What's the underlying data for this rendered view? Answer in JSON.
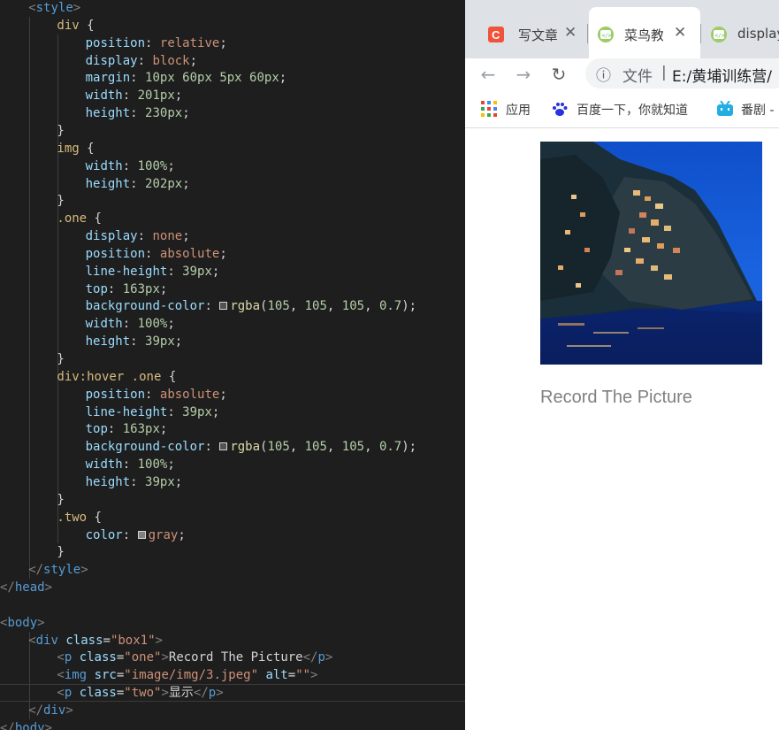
{
  "editor": {
    "lines": [
      [
        [
          "c-bracket",
          "<"
        ],
        [
          "c-tag",
          "style"
        ],
        [
          "c-bracket",
          ">"
        ]
      ],
      [
        [
          "c-sel",
          "div"
        ],
        [
          "c-plain",
          " {"
        ]
      ],
      [
        [
          "c-prop",
          "position"
        ],
        [
          "c-plain",
          ": "
        ],
        [
          "c-val",
          "relative"
        ],
        [
          "c-plain",
          ";"
        ]
      ],
      [
        [
          "c-prop",
          "display"
        ],
        [
          "c-plain",
          ": "
        ],
        [
          "c-val",
          "block"
        ],
        [
          "c-plain",
          ";"
        ]
      ],
      [
        [
          "c-prop",
          "margin"
        ],
        [
          "c-plain",
          ": "
        ],
        [
          "c-num",
          "10px 60px 5px 60px"
        ],
        [
          "c-plain",
          ";"
        ]
      ],
      [
        [
          "c-prop",
          "width"
        ],
        [
          "c-plain",
          ": "
        ],
        [
          "c-num",
          "201px"
        ],
        [
          "c-plain",
          ";"
        ]
      ],
      [
        [
          "c-prop",
          "height"
        ],
        [
          "c-plain",
          ": "
        ],
        [
          "c-num",
          "230px"
        ],
        [
          "c-plain",
          ";"
        ]
      ],
      [
        [
          "c-plain",
          "}"
        ]
      ],
      [
        [
          "c-sel",
          "img"
        ],
        [
          "c-plain",
          " {"
        ]
      ],
      [
        [
          "c-prop",
          "width"
        ],
        [
          "c-plain",
          ": "
        ],
        [
          "c-num",
          "100%"
        ],
        [
          "c-plain",
          ";"
        ]
      ],
      [
        [
          "c-prop",
          "height"
        ],
        [
          "c-plain",
          ": "
        ],
        [
          "c-num",
          "202px"
        ],
        [
          "c-plain",
          ";"
        ]
      ],
      [
        [
          "c-plain",
          "}"
        ]
      ],
      [
        [
          "c-sel",
          ".one"
        ],
        [
          "c-plain",
          " {"
        ]
      ],
      [
        [
          "c-prop",
          "display"
        ],
        [
          "c-plain",
          ": "
        ],
        [
          "c-val",
          "none"
        ],
        [
          "c-plain",
          ";"
        ]
      ],
      [
        [
          "c-prop",
          "position"
        ],
        [
          "c-plain",
          ": "
        ],
        [
          "c-val",
          "absolute"
        ],
        [
          "c-plain",
          ";"
        ]
      ],
      [
        [
          "c-prop",
          "line-height"
        ],
        [
          "c-plain",
          ": "
        ],
        [
          "c-num",
          "39px"
        ],
        [
          "c-plain",
          ";"
        ]
      ],
      [
        [
          "c-prop",
          "top"
        ],
        [
          "c-plain",
          ": "
        ],
        [
          "c-num",
          "163px"
        ],
        [
          "c-plain",
          ";"
        ]
      ],
      [
        [
          "c-prop",
          "background-color"
        ],
        [
          "c-plain",
          ": "
        ],
        [
          "swatch",
          "rgba(105,105,105,0.7)"
        ],
        [
          "c-fn",
          "rgba"
        ],
        [
          "c-plain",
          "("
        ],
        [
          "c-num",
          "105"
        ],
        [
          "c-plain",
          ", "
        ],
        [
          "c-num",
          "105"
        ],
        [
          "c-plain",
          ", "
        ],
        [
          "c-num",
          "105"
        ],
        [
          "c-plain",
          ", "
        ],
        [
          "c-num",
          "0.7"
        ],
        [
          "c-plain",
          ");"
        ]
      ],
      [
        [
          "c-prop",
          "width"
        ],
        [
          "c-plain",
          ": "
        ],
        [
          "c-num",
          "100%"
        ],
        [
          "c-plain",
          ";"
        ]
      ],
      [
        [
          "c-prop",
          "height"
        ],
        [
          "c-plain",
          ": "
        ],
        [
          "c-num",
          "39px"
        ],
        [
          "c-plain",
          ";"
        ]
      ],
      [
        [
          "c-plain",
          "}"
        ]
      ],
      [
        [
          "c-sel",
          "div:hover .one"
        ],
        [
          "c-plain",
          " {"
        ]
      ],
      [
        [
          "c-prop",
          "position"
        ],
        [
          "c-plain",
          ": "
        ],
        [
          "c-val",
          "absolute"
        ],
        [
          "c-plain",
          ";"
        ]
      ],
      [
        [
          "c-prop",
          "line-height"
        ],
        [
          "c-plain",
          ": "
        ],
        [
          "c-num",
          "39px"
        ],
        [
          "c-plain",
          ";"
        ]
      ],
      [
        [
          "c-prop",
          "top"
        ],
        [
          "c-plain",
          ": "
        ],
        [
          "c-num",
          "163px"
        ],
        [
          "c-plain",
          ";"
        ]
      ],
      [
        [
          "c-prop",
          "background-color"
        ],
        [
          "c-plain",
          ": "
        ],
        [
          "swatch",
          "rgba(105,105,105,0.7)"
        ],
        [
          "c-fn",
          "rgba"
        ],
        [
          "c-plain",
          "("
        ],
        [
          "c-num",
          "105"
        ],
        [
          "c-plain",
          ", "
        ],
        [
          "c-num",
          "105"
        ],
        [
          "c-plain",
          ", "
        ],
        [
          "c-num",
          "105"
        ],
        [
          "c-plain",
          ", "
        ],
        [
          "c-num",
          "0.7"
        ],
        [
          "c-plain",
          ");"
        ]
      ],
      [
        [
          "c-prop",
          "width"
        ],
        [
          "c-plain",
          ": "
        ],
        [
          "c-num",
          "100%"
        ],
        [
          "c-plain",
          ";"
        ]
      ],
      [
        [
          "c-prop",
          "height"
        ],
        [
          "c-plain",
          ": "
        ],
        [
          "c-num",
          "39px"
        ],
        [
          "c-plain",
          ";"
        ]
      ],
      [
        [
          "c-plain",
          "}"
        ]
      ],
      [
        [
          "c-sel",
          ".two"
        ],
        [
          "c-plain",
          " {"
        ]
      ],
      [
        [
          "c-prop",
          "color"
        ],
        [
          "c-plain",
          ": "
        ],
        [
          "swatch",
          "gray"
        ],
        [
          "c-val",
          "gray"
        ],
        [
          "c-plain",
          ";"
        ]
      ],
      [
        [
          "c-plain",
          "}"
        ]
      ],
      [
        [
          "c-bracket",
          "</"
        ],
        [
          "c-tag",
          "style"
        ],
        [
          "c-bracket",
          ">"
        ]
      ],
      [
        [
          "c-bracket",
          "</"
        ],
        [
          "c-tag",
          "head"
        ],
        [
          "c-bracket",
          ">"
        ]
      ],
      [],
      [
        [
          "c-bracket",
          "<"
        ],
        [
          "c-tag",
          "body"
        ],
        [
          "c-bracket",
          ">"
        ]
      ],
      [
        [
          "c-bracket",
          "<"
        ],
        [
          "c-tag",
          "div"
        ],
        [
          "c-plain",
          " "
        ],
        [
          "c-attr",
          "class"
        ],
        [
          "c-plain",
          "="
        ],
        [
          "c-str",
          "\"box1\""
        ],
        [
          "c-bracket",
          ">"
        ]
      ],
      [
        [
          "c-bracket",
          "<"
        ],
        [
          "c-tag",
          "p"
        ],
        [
          "c-plain",
          " "
        ],
        [
          "c-attr",
          "class"
        ],
        [
          "c-plain",
          "="
        ],
        [
          "c-str",
          "\"one\""
        ],
        [
          "c-bracket",
          ">"
        ],
        [
          "c-plain",
          "Record The Picture"
        ],
        [
          "c-bracket",
          "</"
        ],
        [
          "c-tag",
          "p"
        ],
        [
          "c-bracket",
          ">"
        ]
      ],
      [
        [
          "c-bracket",
          "<"
        ],
        [
          "c-tag",
          "img"
        ],
        [
          "c-plain",
          " "
        ],
        [
          "c-attr",
          "src"
        ],
        [
          "c-plain",
          "="
        ],
        [
          "c-str",
          "\"image/img/3.jpeg\""
        ],
        [
          "c-plain",
          " "
        ],
        [
          "c-attr",
          "alt"
        ],
        [
          "c-plain",
          "="
        ],
        [
          "c-str",
          "\"\""
        ],
        [
          "c-bracket",
          ">"
        ]
      ],
      [
        [
          "c-bracket",
          "<"
        ],
        [
          "c-tag",
          "p"
        ],
        [
          "c-plain",
          " "
        ],
        [
          "c-attr",
          "class"
        ],
        [
          "c-plain",
          "="
        ],
        [
          "c-str",
          "\"two\""
        ],
        [
          "c-bracket",
          ">"
        ],
        [
          "c-plain",
          "显示"
        ],
        [
          "c-bracket",
          "</"
        ],
        [
          "c-tag",
          "p"
        ],
        [
          "c-bracket",
          ">"
        ]
      ],
      [
        [
          "c-bracket",
          "</"
        ],
        [
          "c-tag",
          "div"
        ],
        [
          "c-bracket",
          ">"
        ]
      ],
      [
        [
          "c-bracket",
          "</"
        ],
        [
          "c-tag",
          "body"
        ],
        [
          "c-bracket",
          ">"
        ]
      ]
    ]
  },
  "browser": {
    "tabs": [
      {
        "label": "写文章",
        "favicon_text": "C",
        "favicon_color": "#f0533a",
        "favicon_style": "csdn"
      },
      {
        "label": "菜鸟教",
        "favicon_text": "</>",
        "favicon_color": "#5cb85c",
        "favicon_style": "runoob"
      },
      {
        "label": "display",
        "favicon_text": "</>",
        "favicon_color": "#5cb85c",
        "favicon_style": "runoob"
      }
    ],
    "nav": {
      "back_icon": "←",
      "forward_icon": "→",
      "reload_icon": "↻"
    },
    "address": {
      "info_icon": "ⓘ",
      "scheme_label": "文件",
      "path": "E:/黄埔训练营/"
    },
    "bookmarks": [
      {
        "label": "应用",
        "icon": "apps-grid-icon"
      },
      {
        "label": "百度一下，你就知道",
        "icon": "baidu-paw-icon"
      },
      {
        "label": "番剧 -",
        "icon": "bilibili-tv-icon"
      }
    ],
    "page": {
      "caption": "Record The Picture",
      "caption_color": "#808080"
    }
  }
}
